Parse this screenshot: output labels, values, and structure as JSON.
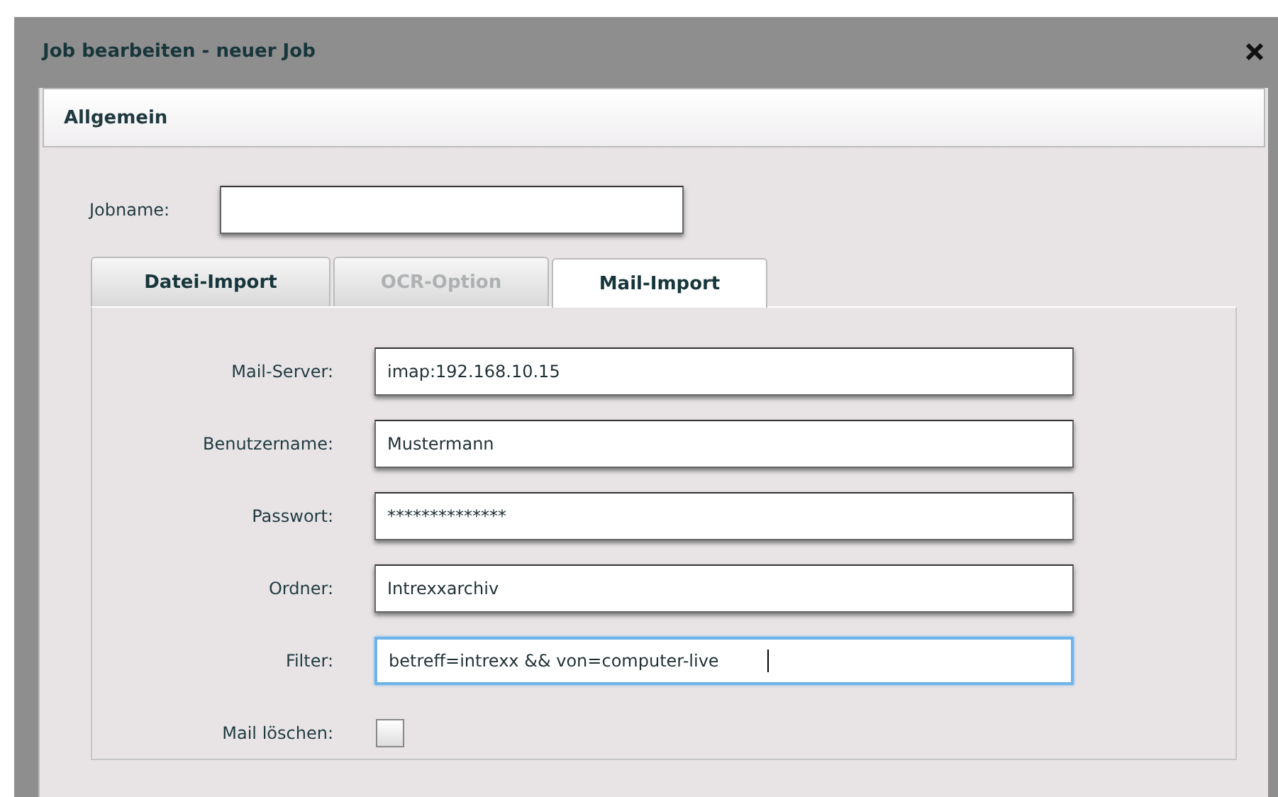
{
  "dialog": {
    "title": "Job bearbeiten - neuer Job"
  },
  "section": {
    "title": "Allgemein"
  },
  "jobname": {
    "label": "Jobname:"
  },
  "tabs": [
    {
      "label": "Datei-Import",
      "selected": false,
      "disabled": false
    },
    {
      "label": "OCR-Option",
      "selected": false,
      "disabled": true
    },
    {
      "label": "Mail-Import",
      "selected": true,
      "disabled": false
    }
  ],
  "fields": [
    {
      "kind": "text",
      "label": "Mail-Server:",
      "value": "imap:192.168.10.15",
      "focused": false
    },
    {
      "kind": "text",
      "label": "Benutzername:",
      "value": "Mustermann",
      "focused": false
    },
    {
      "kind": "text",
      "label": "Passwort:",
      "value": "**************",
      "focused": false
    },
    {
      "kind": "text",
      "label": "Ordner:",
      "value": "Intrexxarchiv",
      "focused": false
    },
    {
      "kind": "text",
      "label": "Filter:",
      "value": "betreff=intrexx && von=computer-live",
      "focused": true
    },
    {
      "kind": "checkbox",
      "label": "Mail löschen:",
      "checked": false
    }
  ]
}
